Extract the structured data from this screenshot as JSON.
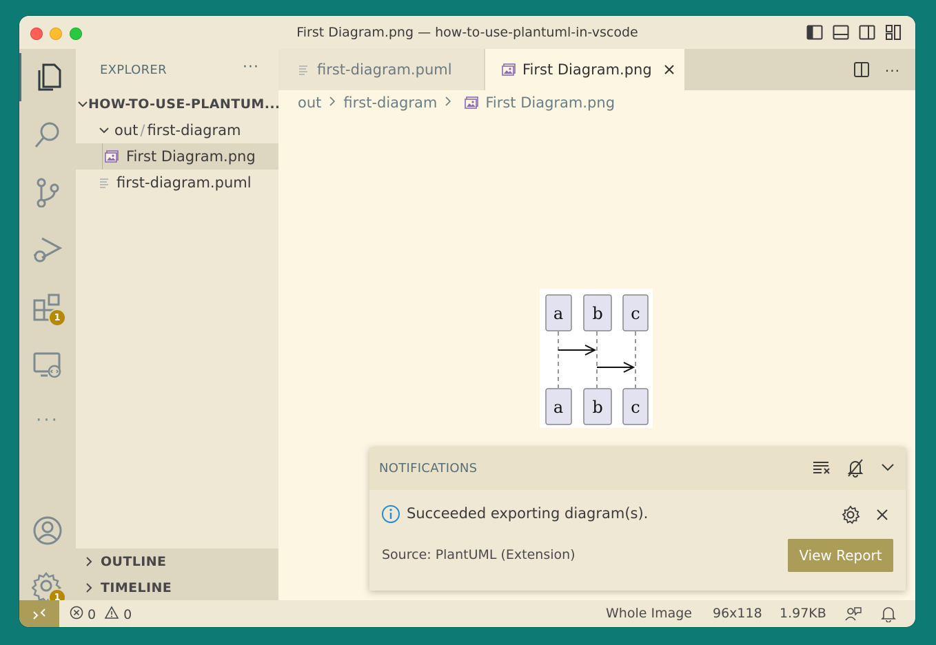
{
  "window": {
    "title": "First Diagram.png — how-to-use-plantuml-in-vscode"
  },
  "activity_bar": {
    "extensions_badge": "1",
    "settings_badge": "1",
    "more": "···"
  },
  "sidebar": {
    "header": "EXPLORER",
    "more": "···",
    "root": "HOW-TO-USE-PLANTUM...",
    "folder": "out",
    "folder_sep": "/",
    "subfolder": "first-diagram",
    "file_png": "First Diagram.png",
    "file_puml": "first-diagram.puml",
    "outline": "OUTLINE",
    "timeline": "TIMELINE"
  },
  "tabs": [
    {
      "label": "first-diagram.puml"
    },
    {
      "label": "First Diagram.png"
    }
  ],
  "breadcrumb": {
    "part1": "out",
    "part2": "first-diagram",
    "part3": "First Diagram.png"
  },
  "diagram": {
    "participants": [
      "a",
      "b",
      "c"
    ]
  },
  "notification": {
    "header": "NOTIFICATIONS",
    "message": "Succeeded exporting diagram(s).",
    "source": "Source: PlantUML (Extension)",
    "button": "View Report"
  },
  "statusbar": {
    "errors": "0",
    "warnings": "0",
    "zoom": "Whole Image",
    "dimensions": "96x118",
    "size": "1.97KB"
  },
  "colors": {
    "accent": "#ab9d58",
    "badge": "#b58900",
    "background": "#fdf6e3",
    "sidebar": "#eee8d5",
    "info_blue": "#268bd2"
  }
}
